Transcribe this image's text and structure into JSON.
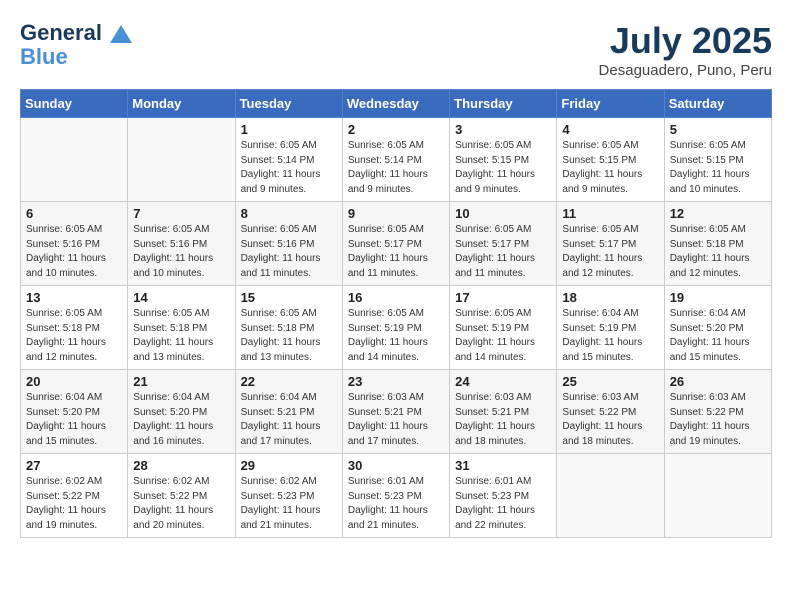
{
  "header": {
    "logo_line1": "General",
    "logo_line2": "Blue",
    "month": "July 2025",
    "location": "Desaguadero, Puno, Peru"
  },
  "weekdays": [
    "Sunday",
    "Monday",
    "Tuesday",
    "Wednesday",
    "Thursday",
    "Friday",
    "Saturday"
  ],
  "weeks": [
    [
      {
        "day": "",
        "info": ""
      },
      {
        "day": "",
        "info": ""
      },
      {
        "day": "1",
        "info": "Sunrise: 6:05 AM\nSunset: 5:14 PM\nDaylight: 11 hours and 9 minutes."
      },
      {
        "day": "2",
        "info": "Sunrise: 6:05 AM\nSunset: 5:14 PM\nDaylight: 11 hours and 9 minutes."
      },
      {
        "day": "3",
        "info": "Sunrise: 6:05 AM\nSunset: 5:15 PM\nDaylight: 11 hours and 9 minutes."
      },
      {
        "day": "4",
        "info": "Sunrise: 6:05 AM\nSunset: 5:15 PM\nDaylight: 11 hours and 9 minutes."
      },
      {
        "day": "5",
        "info": "Sunrise: 6:05 AM\nSunset: 5:15 PM\nDaylight: 11 hours and 10 minutes."
      }
    ],
    [
      {
        "day": "6",
        "info": "Sunrise: 6:05 AM\nSunset: 5:16 PM\nDaylight: 11 hours and 10 minutes."
      },
      {
        "day": "7",
        "info": "Sunrise: 6:05 AM\nSunset: 5:16 PM\nDaylight: 11 hours and 10 minutes."
      },
      {
        "day": "8",
        "info": "Sunrise: 6:05 AM\nSunset: 5:16 PM\nDaylight: 11 hours and 11 minutes."
      },
      {
        "day": "9",
        "info": "Sunrise: 6:05 AM\nSunset: 5:17 PM\nDaylight: 11 hours and 11 minutes."
      },
      {
        "day": "10",
        "info": "Sunrise: 6:05 AM\nSunset: 5:17 PM\nDaylight: 11 hours and 11 minutes."
      },
      {
        "day": "11",
        "info": "Sunrise: 6:05 AM\nSunset: 5:17 PM\nDaylight: 11 hours and 12 minutes."
      },
      {
        "day": "12",
        "info": "Sunrise: 6:05 AM\nSunset: 5:18 PM\nDaylight: 11 hours and 12 minutes."
      }
    ],
    [
      {
        "day": "13",
        "info": "Sunrise: 6:05 AM\nSunset: 5:18 PM\nDaylight: 11 hours and 12 minutes."
      },
      {
        "day": "14",
        "info": "Sunrise: 6:05 AM\nSunset: 5:18 PM\nDaylight: 11 hours and 13 minutes."
      },
      {
        "day": "15",
        "info": "Sunrise: 6:05 AM\nSunset: 5:18 PM\nDaylight: 11 hours and 13 minutes."
      },
      {
        "day": "16",
        "info": "Sunrise: 6:05 AM\nSunset: 5:19 PM\nDaylight: 11 hours and 14 minutes."
      },
      {
        "day": "17",
        "info": "Sunrise: 6:05 AM\nSunset: 5:19 PM\nDaylight: 11 hours and 14 minutes."
      },
      {
        "day": "18",
        "info": "Sunrise: 6:04 AM\nSunset: 5:19 PM\nDaylight: 11 hours and 15 minutes."
      },
      {
        "day": "19",
        "info": "Sunrise: 6:04 AM\nSunset: 5:20 PM\nDaylight: 11 hours and 15 minutes."
      }
    ],
    [
      {
        "day": "20",
        "info": "Sunrise: 6:04 AM\nSunset: 5:20 PM\nDaylight: 11 hours and 15 minutes."
      },
      {
        "day": "21",
        "info": "Sunrise: 6:04 AM\nSunset: 5:20 PM\nDaylight: 11 hours and 16 minutes."
      },
      {
        "day": "22",
        "info": "Sunrise: 6:04 AM\nSunset: 5:21 PM\nDaylight: 11 hours and 17 minutes."
      },
      {
        "day": "23",
        "info": "Sunrise: 6:03 AM\nSunset: 5:21 PM\nDaylight: 11 hours and 17 minutes."
      },
      {
        "day": "24",
        "info": "Sunrise: 6:03 AM\nSunset: 5:21 PM\nDaylight: 11 hours and 18 minutes."
      },
      {
        "day": "25",
        "info": "Sunrise: 6:03 AM\nSunset: 5:22 PM\nDaylight: 11 hours and 18 minutes."
      },
      {
        "day": "26",
        "info": "Sunrise: 6:03 AM\nSunset: 5:22 PM\nDaylight: 11 hours and 19 minutes."
      }
    ],
    [
      {
        "day": "27",
        "info": "Sunrise: 6:02 AM\nSunset: 5:22 PM\nDaylight: 11 hours and 19 minutes."
      },
      {
        "day": "28",
        "info": "Sunrise: 6:02 AM\nSunset: 5:22 PM\nDaylight: 11 hours and 20 minutes."
      },
      {
        "day": "29",
        "info": "Sunrise: 6:02 AM\nSunset: 5:23 PM\nDaylight: 11 hours and 21 minutes."
      },
      {
        "day": "30",
        "info": "Sunrise: 6:01 AM\nSunset: 5:23 PM\nDaylight: 11 hours and 21 minutes."
      },
      {
        "day": "31",
        "info": "Sunrise: 6:01 AM\nSunset: 5:23 PM\nDaylight: 11 hours and 22 minutes."
      },
      {
        "day": "",
        "info": ""
      },
      {
        "day": "",
        "info": ""
      }
    ]
  ]
}
